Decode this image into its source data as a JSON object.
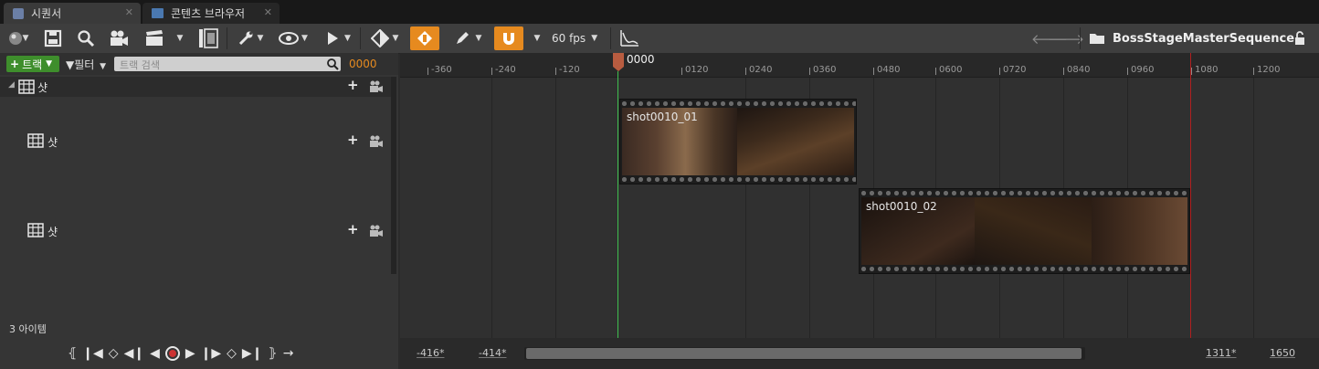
{
  "tabs": [
    {
      "label": "시퀀서",
      "icon": "sequencer-icon",
      "active": true
    },
    {
      "label": "콘텐츠 브라우저",
      "icon": "content-browser-icon",
      "active": false
    }
  ],
  "toolbar": {
    "fps_label": "60 fps",
    "sequence_name": "BossStageMasterSequence",
    "icons": [
      "world-icon",
      "save-icon",
      "search-icon",
      "camera-icon",
      "clapper-icon",
      "render-icon",
      "wrench-icon",
      "eye-icon",
      "play-icon",
      "key-icon",
      "auto-key-icon",
      "pencil-icon",
      "magnet-icon",
      "curve-icon",
      "back-icon",
      "forward-icon",
      "folder-icon",
      "lock-icon"
    ],
    "accent_color": "#e68a1f"
  },
  "left": {
    "add_track_label": "트랙",
    "filter_label": "필터",
    "search_placeholder": "트랙 검색",
    "current_frame": "0000",
    "root_label": "샷",
    "shot_rows": [
      "샷",
      "샷"
    ],
    "item_count": "3 아이템"
  },
  "timeline": {
    "playhead_label": "0000",
    "ticks": [
      "-360",
      "-240",
      "-120",
      "0120",
      "0240",
      "0360",
      "0480",
      "0600",
      "0720",
      "0840",
      "0960",
      "1080",
      "1200"
    ],
    "shots": [
      {
        "name": "shot0010_01"
      },
      {
        "name": "shot0010_02"
      }
    ],
    "range_left_a": "-416*",
    "range_left_b": "-414*",
    "range_right_a": "1311*",
    "range_right_b": "1650"
  },
  "transport": [
    "to-start-icon",
    "prev-key-icon",
    "prev-frame-icon",
    "reverse-icon",
    "record-icon",
    "play-forward-icon",
    "next-frame-icon",
    "next-key-icon",
    "to-end-icon",
    "loop-icon"
  ]
}
